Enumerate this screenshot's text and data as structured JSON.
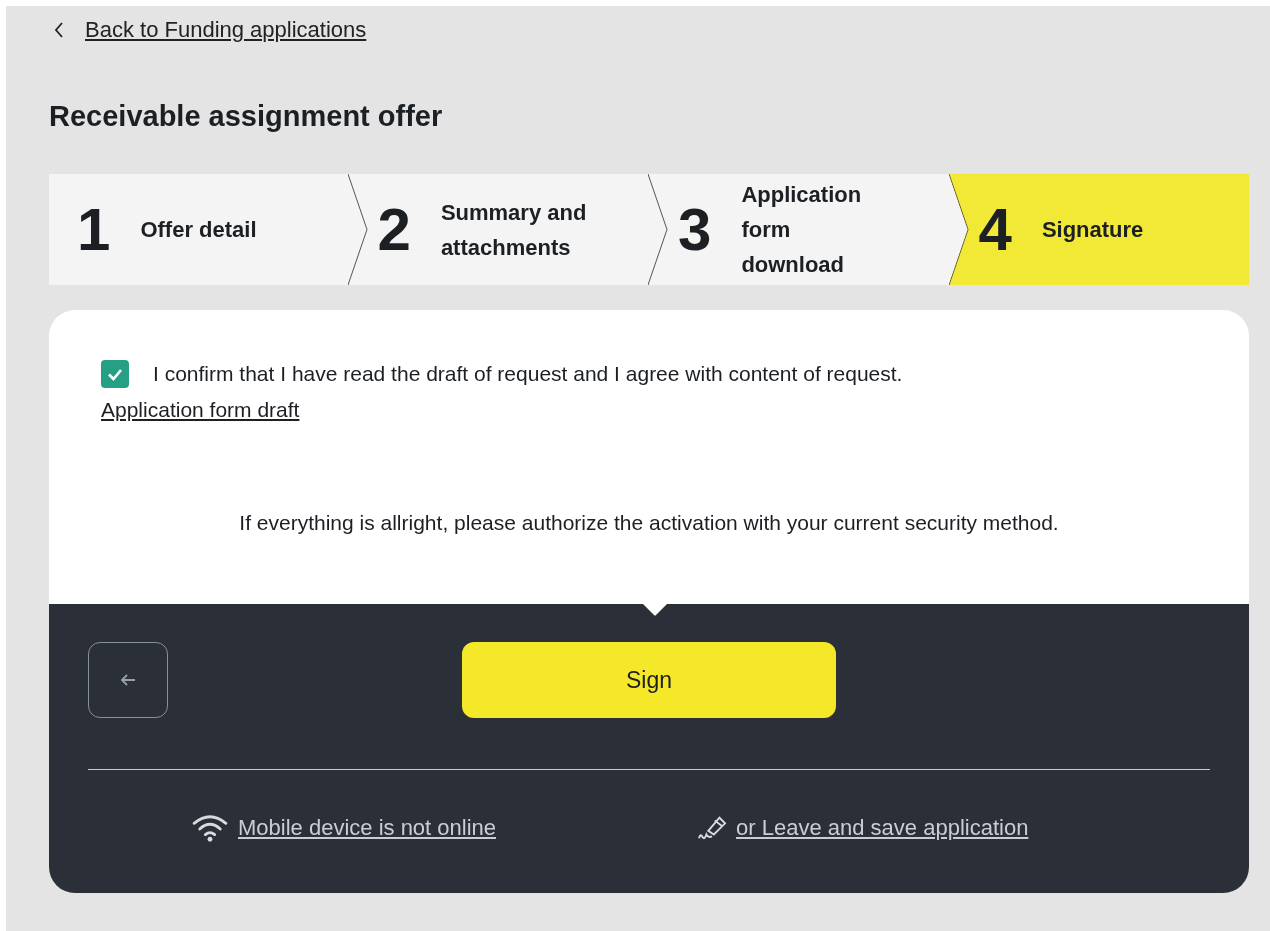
{
  "back_link": "Back to Funding applications",
  "title": "Receivable assignment offer",
  "steps": [
    {
      "number": "1",
      "label": "Offer detail",
      "selected": false
    },
    {
      "number": "2",
      "label": "Summary and attachments",
      "selected": false
    },
    {
      "number": "3",
      "label": "Application form download",
      "selected": false
    },
    {
      "number": "4",
      "label": "Signature",
      "selected": true
    }
  ],
  "confirmation": {
    "checked": true,
    "text": "I confirm that I have read the draft of request and I agree with content of request."
  },
  "draft_link": "Application form draft",
  "instruction": "If everything is allright, please authorize the activation with your current security method.",
  "sign_button": "Sign",
  "footer_links": [
    {
      "kind": "wifi",
      "label": "Mobile device is not online"
    },
    {
      "kind": "pen",
      "label": "or Leave and save application"
    }
  ]
}
